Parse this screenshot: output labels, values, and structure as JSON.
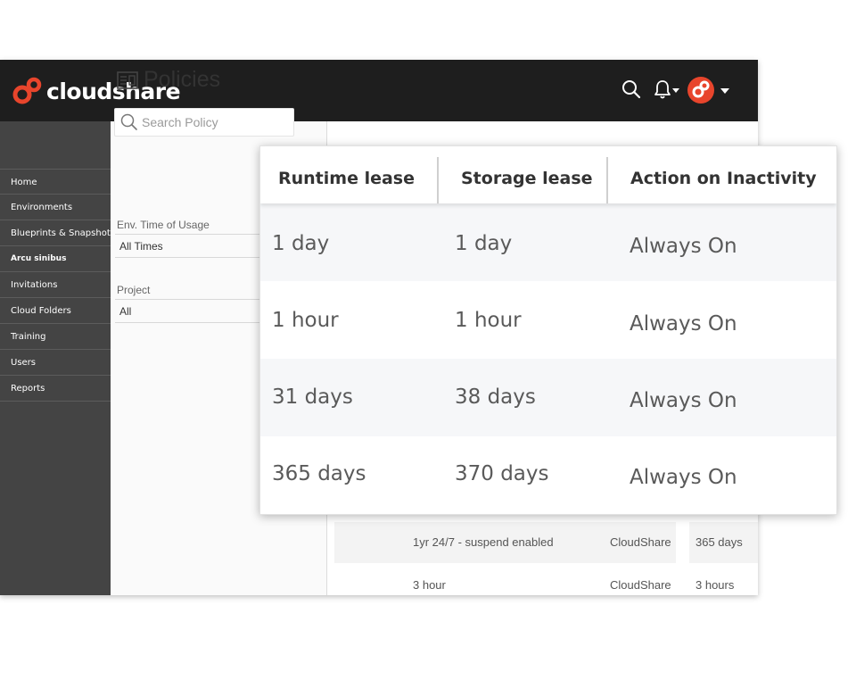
{
  "brand": {
    "name": "cloudshare",
    "accent": "#e8452c"
  },
  "header": {
    "icons": [
      "search-icon",
      "bell-icon",
      "avatar",
      "chevron-down-icon"
    ]
  },
  "sidebar": {
    "items": [
      {
        "label": "Home"
      },
      {
        "label": "Environments"
      },
      {
        "label": "Blueprints & Snapshots"
      },
      {
        "label": "Arcu sinibus"
      },
      {
        "label": "Invitations"
      },
      {
        "label": "Cloud Folders"
      },
      {
        "label": "Training"
      },
      {
        "label": "Users"
      },
      {
        "label": "Reports"
      }
    ]
  },
  "page": {
    "title": "Policies"
  },
  "filters": {
    "search_placeholder": "Search Policy",
    "time_label": "Env. Time of Usage",
    "time_value": "All Times",
    "project_label": "Project",
    "project_value": "All"
  },
  "background_rows": [
    {
      "name": "1yr 24/7 - suspend enabled",
      "owner": "CloudShare",
      "runtime": "365 days"
    },
    {
      "name": "3 hour",
      "owner": "CloudShare",
      "runtime": "3 hours"
    }
  ],
  "table": {
    "headers": [
      "Runtime lease",
      "Storage lease",
      "Action on Inactivity"
    ],
    "rows": [
      {
        "runtime": "1 day",
        "storage": "1 day",
        "action": "Always On"
      },
      {
        "runtime": "1 hour",
        "storage": "1 hour",
        "action": "Always On"
      },
      {
        "runtime": "31 days",
        "storage": "38 days",
        "action": "Always On"
      },
      {
        "runtime": "365 days",
        "storage": "370 days",
        "action": "Always On"
      }
    ]
  }
}
